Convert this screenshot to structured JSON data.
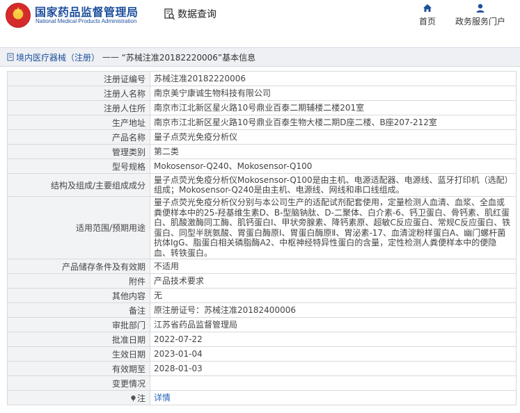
{
  "header": {
    "brand_cn": "国家药品监督管理局",
    "brand_en": "National Medical Products Administration",
    "query_label": "数据查询",
    "nav": {
      "home": "首页",
      "service": "政务服务门户"
    }
  },
  "breadcrumb": {
    "category": "境内医疗器械（注册）",
    "separator": "——",
    "record": "“苏械注准20182220006”基本信息"
  },
  "record": {
    "rows": [
      {
        "label": "注册证编号",
        "value": "苏械注准20182220006"
      },
      {
        "label": "注册人名称",
        "value": "南京美宁康诚生物科技有限公司"
      },
      {
        "label": "注册人住所",
        "value": "南京市江北新区星火路10号鼎业百泰二期辅楼二楼201室"
      },
      {
        "label": "生产地址",
        "value": "南京市江北新区星火路10号鼎业百泰生物大楼二期D座二楼、B座207-212室"
      },
      {
        "label": "产品名称",
        "value": "量子点荧光免疫分析仪"
      },
      {
        "label": "管理类别",
        "value": "第二类"
      },
      {
        "label": "型号规格",
        "value": "Mokosensor-Q240、Mokosensor-Q100"
      },
      {
        "label": "结构及组成/主要组成成分",
        "value": "量子点荧光免疫分析仪Mokosensor-Q100是由主机、电源适配器、电源线、蓝牙打印机（选配）组成；Mokosensor-Q240是由主机、电源线、网线和串口线组成。"
      },
      {
        "label": "适用范围/预期用途",
        "value": "量子点荧光免疫分析仪分别与本公司生产的适配试剂配套使用，定量检测人血清、血浆、全血或粪便样本中的25-羟基维生素D、B-型脑钠肽、D-二聚体、白介素-6、钙卫蛋白、骨钙素、肌红蛋白、肌酸激酶同工酶、肌钙蛋白I、甲状旁腺素、降钙素原、超敏C反应蛋白、常规C反应蛋白、铁蛋白、同型半胱氨酸、胃蛋白酶原Ⅰ、胃蛋白酶原Ⅱ、胃泌素-17、血清淀粉样蛋白A、幽门螺杆菌抗体IgG、脂蛋白相关磷脂酶A2、中枢神经特异性蛋白的含量，定性检测人粪便样本中的便隐血、转铁蛋白。"
      },
      {
        "label": "产品储存条件及有效期",
        "value": "不适用"
      },
      {
        "label": "附件",
        "value": "产品技术要求"
      },
      {
        "label": "其他内容",
        "value": "无"
      },
      {
        "label": "备注",
        "value": "原注册证号：苏械注准20182400006"
      },
      {
        "label": "审批部门",
        "value": "江苏省药品监督管理局"
      },
      {
        "label": "批准日期",
        "value": "2022-07-22"
      },
      {
        "label": "生效日期",
        "value": "2023-01-04"
      },
      {
        "label": "有效期至",
        "value": "2028-01-03"
      },
      {
        "label": "变更情况",
        "value": ""
      },
      {
        "label": "注",
        "value": "详情"
      }
    ]
  },
  "colors": {
    "brand_blue": "#1d4f9c",
    "label_bg": "#f2f3f5",
    "border": "#d6d9de",
    "link": "#2a64b8"
  },
  "icons": [
    "emblem-logo",
    "document-search-icon",
    "home-icon",
    "user-icon",
    "document-icon",
    "pin-icon"
  ]
}
